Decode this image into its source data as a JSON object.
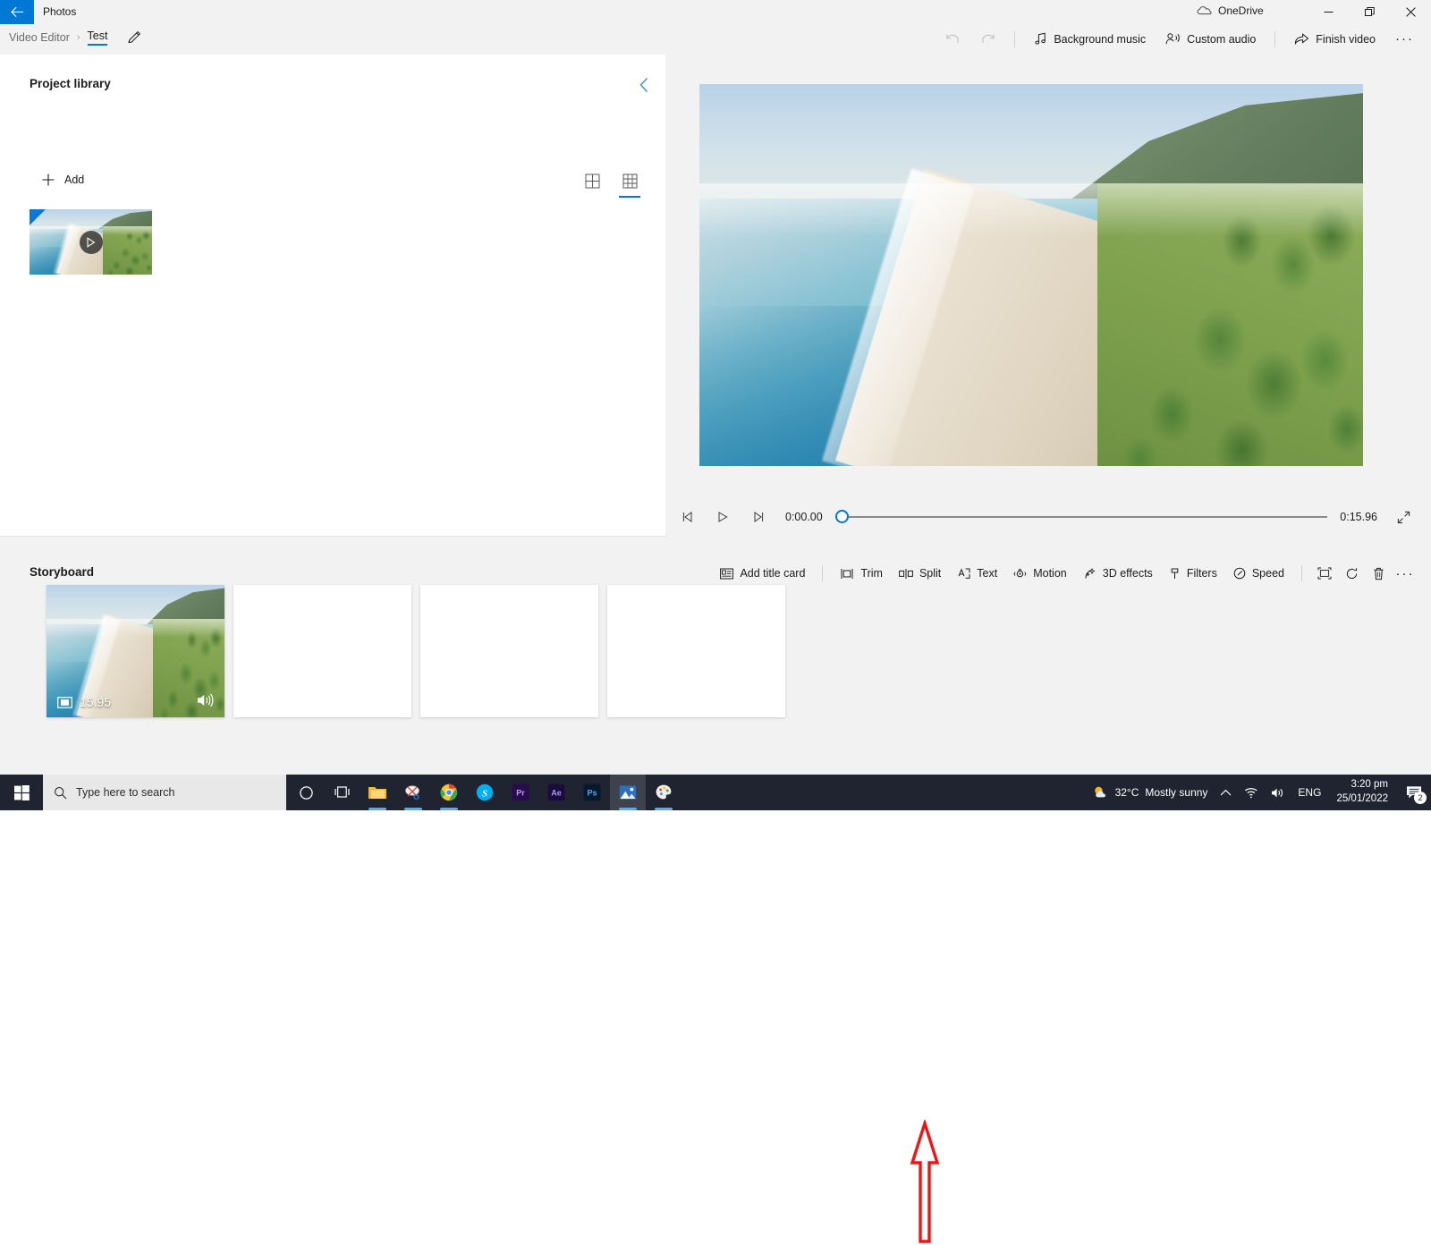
{
  "window": {
    "app_name": "Photos",
    "back_icon": "back-arrow-icon",
    "onedrive_label": "OneDrive",
    "onedrive_icon": "onedrive-cloud-icon",
    "minimize_icon": "minimize-icon",
    "maximize_icon": "restore-icon",
    "close_icon": "close-icon"
  },
  "breadcrumb": {
    "root": "Video Editor",
    "separator": "›",
    "current": "Test",
    "rename_icon": "pencil-icon"
  },
  "command_bar": {
    "undo_icon": "undo-icon",
    "redo_icon": "redo-icon",
    "items": [
      {
        "label": "Background music",
        "icon": "music-note-icon"
      },
      {
        "label": "Custom audio",
        "icon": "person-audio-icon"
      },
      {
        "label": "Finish video",
        "icon": "export-share-icon"
      }
    ],
    "overflow_label": "···",
    "overflow_icon": "more-options-icon"
  },
  "library": {
    "title": "Project library",
    "collapse_icon": "chevron-left-icon",
    "add_label": "Add",
    "add_icon": "plus-icon",
    "view_toggles": [
      {
        "name": "large-grid-view",
        "icon": "grid-2x2-icon",
        "selected": false
      },
      {
        "name": "small-grid-view",
        "icon": "grid-3x3-icon",
        "selected": true
      }
    ],
    "thumbnail": {
      "name": "library-video-thumbnail",
      "play_icon": "play-icon",
      "selected_corner": true
    }
  },
  "preview": {
    "current_time": "0:00.00",
    "total_time": "0:15.96",
    "progress_percent": 0,
    "prev_frame_icon": "previous-frame-icon",
    "play_icon": "play-icon",
    "next_frame_icon": "next-frame-icon",
    "fullscreen_icon": "expand-fullscreen-icon"
  },
  "storyboard": {
    "title": "Storyboard",
    "tools": [
      {
        "label": "Add title card",
        "icon": "title-card-icon",
        "name": "add-title-card-button"
      },
      {
        "label": "Trim",
        "icon": "trim-icon",
        "name": "trim-button"
      },
      {
        "label": "Split",
        "icon": "split-icon",
        "name": "split-button"
      },
      {
        "label": "Text",
        "icon": "text-icon",
        "name": "text-button"
      },
      {
        "label": "Motion",
        "icon": "motion-icon",
        "name": "motion-button"
      },
      {
        "label": "3D effects",
        "icon": "3d-effects-icon",
        "name": "three-d-effects-button"
      },
      {
        "label": "Filters",
        "icon": "filters-icon",
        "name": "filters-button"
      },
      {
        "label": "Speed",
        "icon": "speed-icon",
        "name": "speed-button"
      }
    ],
    "icon_tools": [
      {
        "icon": "aspect-ratio-icon",
        "name": "aspect-ratio-button"
      },
      {
        "icon": "rotate-icon",
        "name": "rotate-button"
      },
      {
        "icon": "delete-trash-icon",
        "name": "delete-button"
      },
      {
        "icon": "more-options-icon",
        "name": "storyboard-more-button"
      }
    ],
    "clips": [
      {
        "duration": "15.95",
        "filled": true,
        "selected": true,
        "duration_icon": "filmstrip-icon",
        "audio_icon": "volume-on-icon"
      },
      {
        "duration": "",
        "filled": false,
        "selected": false
      },
      {
        "duration": "",
        "filled": false,
        "selected": false
      },
      {
        "duration": "",
        "filled": false,
        "selected": false
      }
    ]
  },
  "annotation": {
    "type": "arrow-up",
    "color": "#f01414",
    "points_to": "Text"
  },
  "taskbar": {
    "start_icon": "windows-start-icon",
    "search_placeholder": "Type here to search",
    "search_icon": "search-icon",
    "apps": [
      {
        "name": "cortana-icon",
        "running": false
      },
      {
        "name": "task-view-icon",
        "running": false
      },
      {
        "name": "file-explorer-icon",
        "running": true
      },
      {
        "name": "snip-and-sketch-icon",
        "running": true
      },
      {
        "name": "chrome-icon",
        "running": true
      },
      {
        "name": "skype-icon",
        "running": false
      },
      {
        "name": "premiere-pro-icon",
        "label": "Pr",
        "running": false
      },
      {
        "name": "after-effects-icon",
        "label": "Ae",
        "running": false
      },
      {
        "name": "photoshop-icon",
        "label": "Ps",
        "running": false
      },
      {
        "name": "photos-icon",
        "running": true,
        "active": true
      },
      {
        "name": "paint-3d-icon",
        "running": true
      }
    ],
    "tray": {
      "weather_temp": "32°C",
      "weather_desc": "Mostly sunny",
      "weather_icon": "sun-cloud-icon",
      "chevron_icon": "show-hidden-icons-icon",
      "network_icon": "wifi-icon",
      "volume_icon": "speaker-icon",
      "language": "ENG",
      "time": "3:20 pm",
      "date": "25/01/2022",
      "notification_icon": "action-center-icon",
      "notification_count": "2"
    }
  },
  "colors": {
    "accent": "#0078d4",
    "annotation_red": "#f01414",
    "taskbar_bg": "#1f2430",
    "panel_bg": "#f2f2f2"
  }
}
